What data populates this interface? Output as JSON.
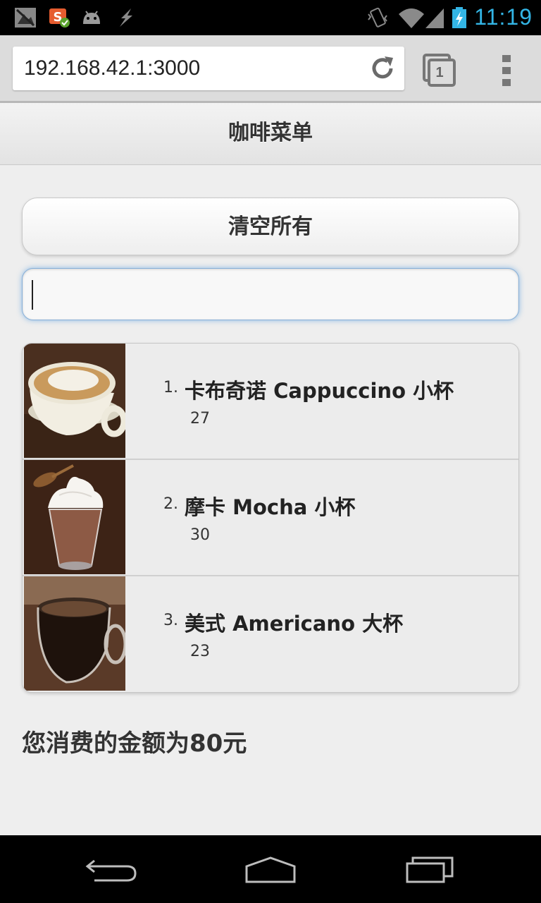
{
  "status_bar": {
    "time": "11:19",
    "icons": [
      "screenshot-icon",
      "app-s-icon",
      "android-icon",
      "usb-debug-icon",
      "vibrate-icon",
      "wifi-icon",
      "signal-icon",
      "battery-charging-icon"
    ]
  },
  "browser": {
    "url": "192.168.42.1:3000",
    "tab_count": "1",
    "icons": [
      "reload-icon",
      "tabs-icon",
      "overflow-menu-icon"
    ]
  },
  "page": {
    "title": "咖啡菜单",
    "clear_button": "清空所有",
    "search": {
      "value": "",
      "placeholder": ""
    },
    "items": [
      {
        "number": "1.",
        "name": "卡布奇诺 Cappuccino 小杯",
        "price": "27",
        "image": "cappuccino"
      },
      {
        "number": "2.",
        "name": "摩卡 Mocha 小杯",
        "price": "30",
        "image": "mocha"
      },
      {
        "number": "3.",
        "name": "美式 Americano 大杯",
        "price": "23",
        "image": "americano"
      }
    ],
    "total": "您消费的金额为80元"
  },
  "nav_bar": {
    "icons": [
      "back-icon",
      "home-icon",
      "recent-apps-icon"
    ]
  }
}
